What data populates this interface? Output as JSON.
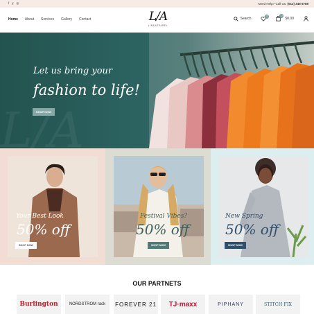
{
  "topbar": {
    "help_prefix": "Need Help? Call Us:",
    "phone": "(012) 345 6789",
    "social": [
      "f",
      "y",
      "◎"
    ]
  },
  "header": {
    "nav": [
      "Home",
      "About",
      "Services",
      "Gallery",
      "Contact"
    ],
    "active_nav": "Home",
    "logo_mark": "L/A",
    "logo_sub": "LINEAPPAREL",
    "search_label": "Search",
    "wishlist_count": "0",
    "cart_count": "0",
    "cart_total": "$0.00"
  },
  "hero": {
    "line1": "Let us bring your",
    "line2": "fashion to life!",
    "button": "SHOP NOW",
    "ghost": "L/A"
  },
  "promos": [
    {
      "line1": "Your Best Look",
      "line2": "50% off",
      "button": "SHOP NOW"
    },
    {
      "line1": "Festival Vibes?",
      "line2": "50% off",
      "button": "SHOP NOW"
    },
    {
      "line1": "New Spring",
      "line2": "50% off",
      "button": "SHOP NOW"
    }
  ],
  "partners": {
    "title": "OUR PARTNETS",
    "brands": [
      "Burlington",
      "NORDSTROM rack",
      "FOREVER 21",
      "TJ·maxx",
      "PIPHANY",
      "STITCH FIX"
    ]
  },
  "colors": {
    "hero_teal": "#2c6361",
    "accent_teal": "#86a9a8",
    "topbar_bg": "#f6ebe6",
    "promo_peach": "#f1ddd3",
    "promo_sage": "#dcdcd2",
    "promo_blue": "#dceef0"
  }
}
